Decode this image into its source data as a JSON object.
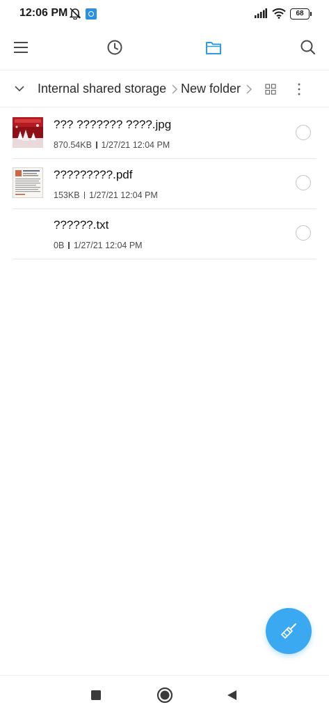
{
  "status_bar": {
    "time": "12:06 PM",
    "battery": "68",
    "icons": [
      "dnd-off-icon",
      "app-notification-icon",
      "signal-icon",
      "wifi-icon",
      "battery-icon"
    ]
  },
  "toolbar": {
    "icons": [
      "menu-icon",
      "recent-clock-icon",
      "folder-icon",
      "search-icon"
    ],
    "active_color": "#2d9be6"
  },
  "breadcrumb": {
    "items": [
      "Internal shared storage",
      "New folder"
    ]
  },
  "files": [
    {
      "name": "??? ??????? ????.jpg",
      "size": "870.54KB",
      "date": "1/27/21 12:04 PM",
      "type": "image"
    },
    {
      "name": "?????????.pdf",
      "size": "153KB",
      "date": "1/27/21 12:04 PM",
      "type": "pdf"
    },
    {
      "name": "??????.txt",
      "size": "0B",
      "date": "1/27/21 12:04 PM",
      "type": "text"
    }
  ],
  "fab": {
    "icon": "clean-brush-icon",
    "color": "#3ba9f1"
  },
  "nav": {
    "icons": [
      "recents-square-icon",
      "home-circle-icon",
      "back-triangle-icon"
    ]
  }
}
